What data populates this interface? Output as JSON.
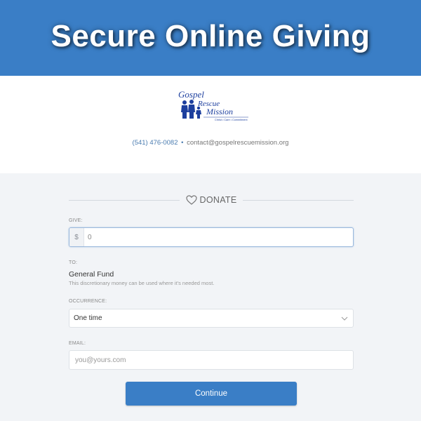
{
  "banner": {
    "title": "Secure Online Giving"
  },
  "organization": {
    "logo": {
      "line1": "Gospel",
      "line2": "Rescue",
      "line3": "Mission",
      "tagline": "Christ • Care • Commitment"
    },
    "phone": "(541) 476-0082",
    "separator": "•",
    "email": "contact@gospelrescuemission.org"
  },
  "form": {
    "heading": "DONATE",
    "give": {
      "label": "GIVE:",
      "currency": "$",
      "value": "0"
    },
    "to": {
      "label": "TO:",
      "fund": "General Fund",
      "description": "This discretionary money can be used where it's needed most."
    },
    "occurrence": {
      "label": "OCCURRENCE:",
      "selected": "One time"
    },
    "email": {
      "label": "EMAIL:",
      "placeholder": "you@yours.com"
    },
    "continue_label": "Continue"
  },
  "colors": {
    "accent": "#3a7ec6",
    "logo_blue": "#1d3f9e",
    "page_background": "#f2f4f7"
  },
  "icons": {
    "heading": "heart-icon",
    "select": "chevron-down-icon"
  }
}
